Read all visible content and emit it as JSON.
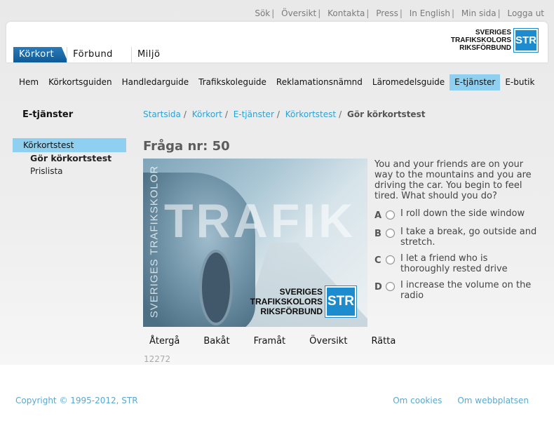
{
  "toplinks": [
    "Sök",
    "Översikt",
    "Kontakta",
    "Press",
    "In English",
    "Min sida",
    "Logga ut"
  ],
  "tabs": [
    "Körkort",
    "Förbund",
    "Miljö"
  ],
  "logo": {
    "line1": "SVERIGES",
    "line2": "TRAFIKSKOLORS",
    "line3": "RIKSFÖRBUND",
    "mark": "STR"
  },
  "nav": [
    "Hem",
    "Körkortsguiden",
    "Handledarguide",
    "Trafikskoleguide",
    "Reklamationsnämnd",
    "Läromedelsguide",
    "E-tjänster",
    "E-butik"
  ],
  "sidebar": {
    "title": "E-tjänster",
    "item": "Körkortstest",
    "sub1": "Gör körkortstest",
    "sub2": "Prislista"
  },
  "breadcrumb": {
    "items": [
      "Startsida",
      "Körkort",
      "E-tjänster",
      "Körkortstest"
    ],
    "current": "Gör körkortstest"
  },
  "question": {
    "title": "Fråga nr: 50",
    "text": "You and your friends are on your way to the mountains and you are driving the car. You begin to feel tired. What should you do?",
    "image_vertical": "SVERIGES TRAFIKSKOLOR",
    "image_watermark": "TRAFIK",
    "answers": [
      {
        "letter": "A",
        "text": "I roll down the side window"
      },
      {
        "letter": "B",
        "text": "I take a break, go outside and stretch."
      },
      {
        "letter": "C",
        "text": "I let a friend who is thoroughly rested drive"
      },
      {
        "letter": "D",
        "text": "I increase the volume on the radio"
      }
    ],
    "id": "12272"
  },
  "actions": [
    "Återgå",
    "Bakåt",
    "Framåt",
    "Översikt",
    "Rätta"
  ],
  "footer": {
    "copyright": "Copyright © 1995-2012, STR",
    "links": [
      "Om cookies",
      "Om webbplatsen"
    ]
  },
  "colors": {
    "accent": "#8fd0f0",
    "brand": "#1d8ccf",
    "link": "#2aa3d6"
  }
}
